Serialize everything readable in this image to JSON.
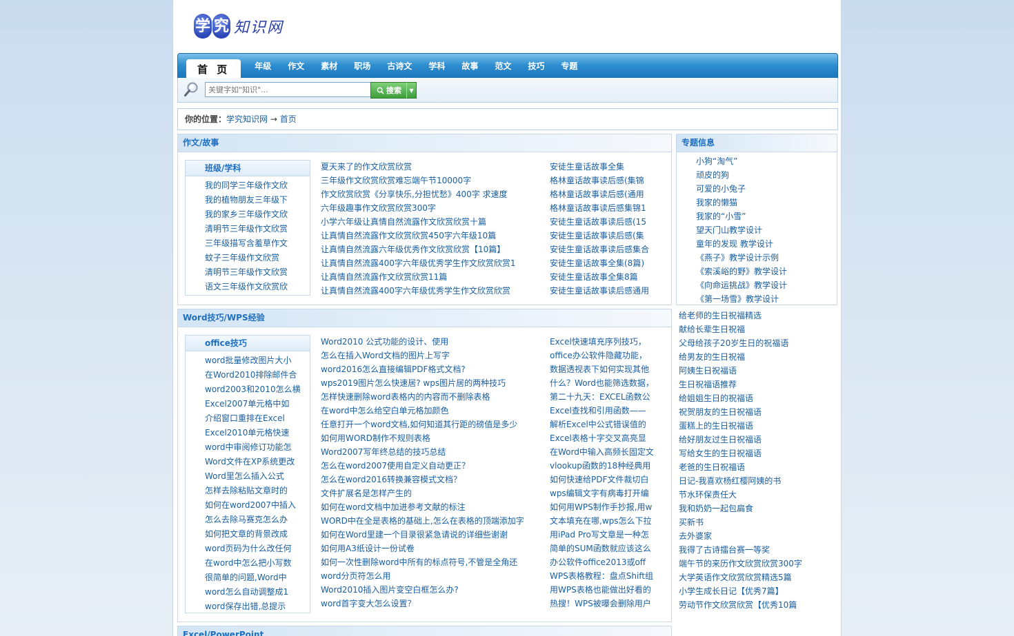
{
  "site": {
    "logo_badge_1": "学",
    "logo_badge_2": "究",
    "logo_text": "知识网"
  },
  "nav": {
    "items": [
      "首 页",
      "年级",
      "作文",
      "素材",
      "职场",
      "古诗文",
      "学科",
      "故事",
      "范文",
      "技巧",
      "专题"
    ]
  },
  "search": {
    "placeholder": "关键字如\"知识\"...",
    "button_label": "搜索"
  },
  "breadcrumb": {
    "label": "你的位置：",
    "home": "学究知识网",
    "sep": " → ",
    "current": "首页"
  },
  "section1": {
    "title": "作文/故事",
    "side_title": "班级/学科",
    "side_items": [
      "我的同学三年级作文欣",
      "我的植物朋友三年级下",
      "我的家乡三年级作文欣",
      "清明节三年级作文欣赏",
      "三年级描写含羞草作文",
      "蚊子三年级作文欣赏",
      "清明节三年级作文欣赏",
      "语文三年级作文欣赏欣"
    ],
    "col1": [
      "夏天来了的作文欣赏欣赏",
      "三年级作文欣赏欣赏难忘端午节10000字",
      "作文欣赏欣赏《分享快乐,分担忧愁》400字 求速度",
      "六年级趣事作文欣赏欣赏300字",
      "小学六年级让真情自然流露作文欣赏欣赏十篇",
      "让真情自然流露作文欣赏欣赏450字六年级10篇",
      "让真情自然流露六年级优秀作文欣赏欣赏【10篇】",
      "让真情自然流露400字六年级优秀学生作文欣赏欣赏1",
      "让真情自然流露作文欣赏欣赏11篇",
      "让真情自然流露400字六年级优秀学生作文欣赏欣赏"
    ],
    "col2": [
      "安徒生童话故事全集",
      "格林童话故事读后感(集锦",
      "格林童话故事读后感(通用",
      "格林童话故事读后感集锦1",
      "安徒生童话故事读后感(15",
      "安徒生童话故事读后感(集",
      "安徒生童话故事读后感集合",
      "安徒生童话故事全集(8篇)",
      "安徒生童话故事全集8篇",
      "安徒生童话故事读后感通用"
    ]
  },
  "special": {
    "title": "专题信息",
    "items": [
      "小狗“淘气”",
      "顽皮的狗",
      "可爱的小兔子",
      "我家的懒猫",
      "我家的“小雪”",
      "望天门山教学设计",
      "童年的发现 教学设计",
      "《燕子》教学设计示例",
      "《索溪峪的野》教学设计",
      "《向命运挑战》教学设计",
      "《第一场雪》教学设计"
    ]
  },
  "section2": {
    "title": "Word技巧/WPS经验",
    "side_title": "office技巧",
    "side_items": [
      "word批量修改图片大小",
      "在Word2010排除邮件合",
      "word2003和2010怎么横",
      "Excel2007单元格中如",
      "介绍窗口重排在Excel",
      "Excel2010单元格快速",
      "word中审阅修订功能怎",
      "Word文件在XP系统更改",
      "Word里怎么插入公式",
      "怎样去除粘贴文章时的",
      "如何在word2007中插入",
      "怎么去除马赛克怎么办",
      "如何把文章的背景改成",
      "word页码为什么改任何",
      "在word中怎么把小写数",
      "很简单的问题,Word中",
      "word怎么自动调整成1",
      "word保存出错,总提示"
    ],
    "col1": [
      "Word2010 公式功能的设计、使用",
      "怎么在插入Word文档的图片上写字",
      "word2016怎么直接编辑PDF格式文档?",
      "wps2019图片怎么快速居? wps图片居的两种技巧",
      "怎样快速删除word表格内的内容而不删除表格",
      "在word中怎么给空白单元格加颜色",
      "任意打开一个word文档,如何知道其行距的磅值是多少",
      "如何用WORD制作不规则表格",
      "Word2007写年终总结的技巧总结",
      "怎么在word2007使用自定义自动更正？",
      "怎么在word2016转换兼容模式文档？",
      "文件扩展名是怎样产生的",
      "如何在word文档中加进参考文献的标注",
      "WORD中在全是表格的基础上,怎么在表格的顶端添加字",
      "如何在Word里建一个目录很紧急请说的详细些谢谢",
      "如何用A3纸设计一份试卷",
      "如何一次性删除word中所有的标点符号,不管是全角还",
      "word分页符怎么用",
      "Word2010插入图片变空白框怎么办?",
      "word首字变大怎么设置？"
    ],
    "col2": [
      "Excel快速填充序列技巧，",
      "office办公软件隐藏功能，",
      "数据透视表下如何实现其他",
      "什么？Word也能筛选数据，",
      "第二十九天：EXCEL函数公",
      "Excel查找和引用函数——",
      "解析Excel中公式错误值的",
      "Excel表格十字交叉高亮显",
      "在Word中输入高频长固定文",
      "vlookup函数的18种经典用",
      "如何快速给PDF文件裁切白",
      "wps编辑文字有病毒打开编",
      "如何用WPS制作手抄报,用w",
      "文本填充在哪,wps怎么下拉",
      "用iPad Pro写文章是一种怎",
      "简单的SUM函数就应该这么",
      "办公软件office2013或off",
      "WPS表格教程：盘点Shift组",
      "用WPS表格也能做出好看的",
      "热搜！WPS被曝会删除用户"
    ]
  },
  "right_list": [
    "给老师的生日祝福精选",
    "献给长辈生日祝福",
    "父母给孩子20岁生日的祝福语",
    "给男友的生日祝福",
    "阿姨生日祝福语",
    "生日祝福语推荐",
    "给姐姐生日的祝福语",
    "祝贺朋友的生日祝福语",
    "蛋糕上的生日祝福语",
    "给好朋友过生日祝福语",
    "写给女生的生日祝福语",
    "老爸的生日祝福语",
    "日记-我喜欢杨红樱阿姨的书",
    "节水环保责任大",
    "我和奶奶一起包扁食",
    "买新书",
    "去外婆家",
    "我得了古诗擂台赛一等奖",
    "端午节的来历作文欣赏欣赏300字",
    "大学英语作文欣赏欣赏精选5篇",
    "小学生成长日记【优秀7篇】",
    "劳动节作文欣赏欣赏【优秀10篇"
  ],
  "section3": {
    "title": "Excel/PowerPoint"
  }
}
